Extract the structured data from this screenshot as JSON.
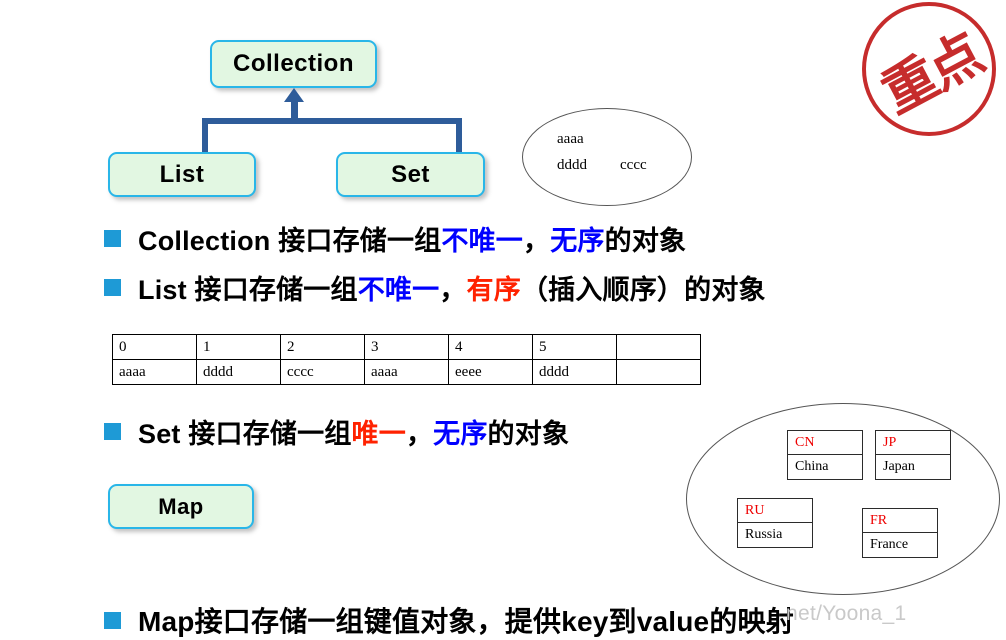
{
  "diagram": {
    "collection_label": "Collection",
    "list_label": "List",
    "set_label": "Set",
    "map_label": "Map"
  },
  "set_ellipse": {
    "items": [
      "aaaa",
      "dddd",
      "cccc"
    ]
  },
  "bullets": {
    "collection": {
      "segment_1": "Collection 接口存储一组",
      "highlight_1": "不唯一",
      "segment_2": "，",
      "highlight_2": "无序",
      "segment_3": "的对象"
    },
    "list": {
      "segment_1": "List 接口存储一组",
      "highlight_1": "不唯一",
      "segment_2": "，",
      "highlight_2": "有序",
      "segment_3": "（插入顺序）的对象"
    },
    "set": {
      "segment_1": "Set 接口存储一组",
      "highlight_1": "唯一",
      "segment_2": "，",
      "highlight_2": "无序",
      "segment_3": "的对象"
    },
    "map": {
      "segment_1": "Map接口存储一组键值对象，提供key到value的映射"
    }
  },
  "index_table": {
    "indices": [
      "0",
      "1",
      "2",
      "3",
      "4",
      "5",
      ""
    ],
    "values": [
      "aaaa",
      "dddd",
      "cccc",
      "aaaa",
      "eeee",
      "dddd",
      ""
    ]
  },
  "map_entries": [
    {
      "key": "CN",
      "value": "China"
    },
    {
      "key": "JP",
      "value": "Japan"
    },
    {
      "key": "RU",
      "value": "Russia"
    },
    {
      "key": "FR",
      "value": "France"
    }
  ],
  "stamp": {
    "label": "重点"
  },
  "watermark": {
    "text": "net/Yoona_1"
  },
  "colors": {
    "node_fill": "#e2f7e2",
    "node_border": "#29b6e8",
    "connector": "#2e5c9a",
    "bullet_square": "#1e9ad6",
    "highlight_blue": "#0000ff",
    "highlight_red": "#ff2200",
    "stamp_red": "#c21b1b"
  }
}
